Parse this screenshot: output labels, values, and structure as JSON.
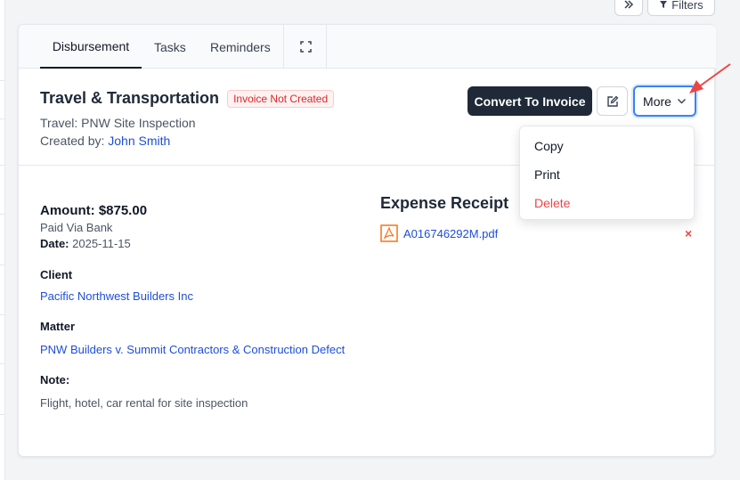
{
  "toolbar": {
    "filters_label": "Filters"
  },
  "tabs": [
    {
      "label": "Disbursement",
      "active": true
    },
    {
      "label": "Tasks",
      "active": false
    },
    {
      "label": "Reminders",
      "active": false
    }
  ],
  "header": {
    "title": "Travel & Transportation",
    "status_badge": "Invoice Not Created",
    "subtitle": "Travel: PNW Site Inspection",
    "created_by_label": "Created by:",
    "created_by_name": "John Smith"
  },
  "actions": {
    "convert_label": "Convert To Invoice",
    "more_label": "More"
  },
  "more_menu": {
    "items": [
      {
        "label": "Copy"
      },
      {
        "label": "Print"
      },
      {
        "label": "Delete"
      }
    ]
  },
  "details": {
    "amount": "Amount: $875.00",
    "paid_via": "Paid Via Bank",
    "date_label": "Date:",
    "date_value": "2025-11-15",
    "client_label": "Client",
    "client_value": "Pacific Northwest Builders Inc",
    "matter_label": "Matter",
    "matter_value": "PNW Builders v. Summit Contractors & Construction Defect",
    "note_label": "Note:",
    "note_value": "Flight, hotel, car rental for site inspection"
  },
  "receipt": {
    "title": "Expense Receipt",
    "file_name": "A016746292M.pdf",
    "delete_glyph": "×"
  },
  "colors": {
    "accent": "#3b82f6",
    "primary_dark": "#1f2937",
    "link": "#1d4ed8",
    "danger": "#ef4444",
    "arrow": "#ef4444"
  }
}
